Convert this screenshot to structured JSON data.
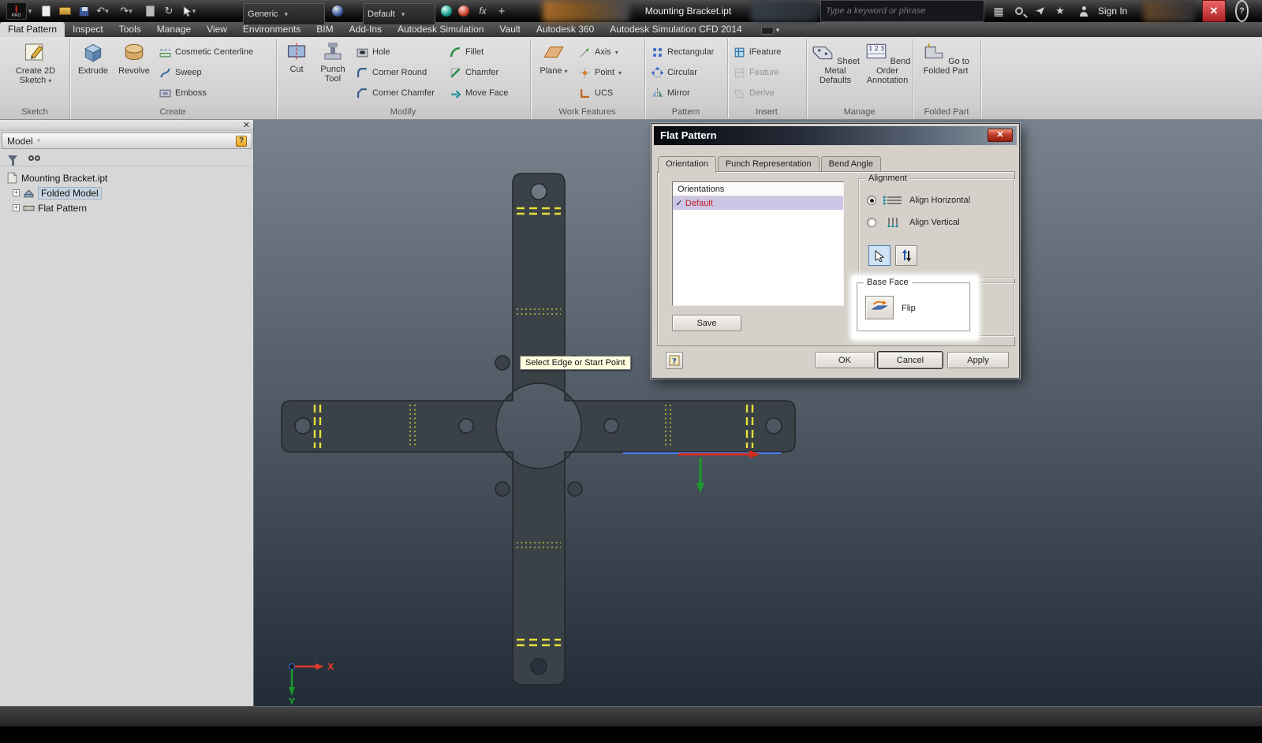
{
  "titlebar": {
    "app_letter": "I",
    "app_label": "PRO",
    "material_value": "Generic",
    "appearance_value": "Default",
    "document_title": "Mounting Bracket.ipt",
    "search_placeholder": "Type a keyword or phrase",
    "sign_in_label": "Sign In"
  },
  "ribbon": {
    "tabs": [
      {
        "label": "Flat Pattern"
      },
      {
        "label": "Inspect"
      },
      {
        "label": "Tools"
      },
      {
        "label": "Manage"
      },
      {
        "label": "View"
      },
      {
        "label": "Environments"
      },
      {
        "label": "BIM"
      },
      {
        "label": "Add-Ins"
      },
      {
        "label": "Autodesk Simulation"
      },
      {
        "label": "Vault"
      },
      {
        "label": "Autodesk 360"
      },
      {
        "label": "Autodesk Simulation CFD 2014"
      }
    ],
    "buttons": {
      "create_2d_sketch": "Create 2D Sketch",
      "extrude": "Extrude",
      "revolve": "Revolve",
      "cosmetic_centerline": "Cosmetic Centerline",
      "sweep": "Sweep",
      "emboss": "Emboss",
      "cut": "Cut",
      "punch_tool": "Punch Tool",
      "hole": "Hole",
      "corner_round": "Corner Round",
      "corner_chamfer": "Corner Chamfer",
      "fillet": "Fillet",
      "chamfer": "Chamfer",
      "move_face": "Move Face",
      "plane": "Plane",
      "axis": "Axis",
      "point": "Point",
      "ucs": "UCS",
      "rectangular": "Rectangular",
      "circular": "Circular",
      "mirror": "Mirror",
      "ifeature": "iFeature",
      "feature": "Feature",
      "derive": "Derive",
      "sheet_metal_defaults": "Sheet Metal Defaults",
      "bend_order_annotation": "Bend Order Annotation",
      "go_to_folded_part": "Go to Folded Part"
    },
    "panel_labels": {
      "sketch": "Sketch",
      "create": "Create",
      "modify": "Modify",
      "work_features": "Work Features",
      "pattern": "Pattern",
      "insert": "Insert",
      "manage": "Manage",
      "folded_part": "Folded Part"
    }
  },
  "browser": {
    "title": "Model",
    "tree": [
      {
        "label": "Mounting Bracket.ipt"
      },
      {
        "label": "Folded Model"
      },
      {
        "label": "Flat Pattern"
      }
    ]
  },
  "viewport": {
    "tooltip": "Select Edge or Start Point",
    "axis_x": "X",
    "axis_y": "Y"
  },
  "dialog": {
    "title": "Flat Pattern",
    "tabs": [
      {
        "label": "Orientation"
      },
      {
        "label": "Punch Representation"
      },
      {
        "label": "Bend Angle"
      }
    ],
    "orientations_header": "Orientations",
    "orientation_item": "Default",
    "save_label": "Save",
    "alignment_label": "Alignment",
    "align_horizontal": "Align Horizontal",
    "align_vertical": "Align Vertical",
    "base_face_label": "Base Face",
    "flip_label": "Flip",
    "ok_label": "OK",
    "cancel_label": "Cancel",
    "apply_label": "Apply"
  },
  "colors": {
    "bend_line_yellow": "#e6e03a",
    "selection_lavender": "#cdc6e6",
    "orientation_text_red": "#c02020",
    "close_red": "#c23b2a",
    "base_face_highlight": "#ffffff"
  }
}
